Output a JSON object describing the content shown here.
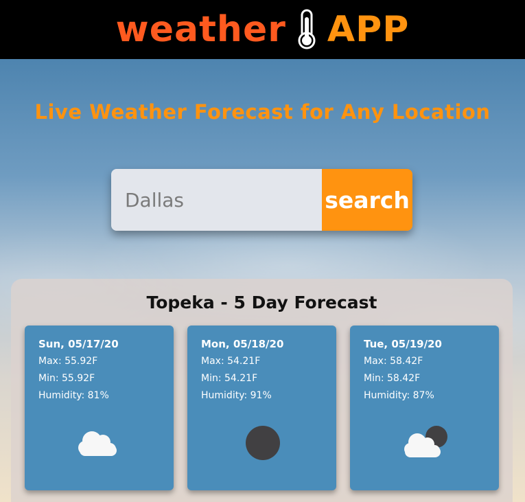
{
  "header": {
    "brand_word_1": "weather",
    "brand_word_2": "APP",
    "brand_icon": "thermometer-icon",
    "colors": {
      "background": "#000000",
      "weather": "#ff5a1f",
      "app": "#ff9310"
    }
  },
  "headline": "Live Weather Forecast for Any Location",
  "search": {
    "value": "",
    "placeholder": "Dallas",
    "button_label": "search",
    "button_color": "#ff9310"
  },
  "forecast": {
    "title": "Topeka - 5 Day Forecast",
    "days": [
      {
        "date": "Sun, 05/17/20",
        "max": "Max: 55.92F",
        "min": "Min: 55.92F",
        "humidity": "Humidity: 81%",
        "icon": "cloudy-icon"
      },
      {
        "date": "Mon, 05/18/20",
        "max": "Max: 54.21F",
        "min": "Min: 54.21F",
        "humidity": "Humidity: 91%",
        "icon": "clear-night-icon"
      },
      {
        "date": "Tue, 05/19/20",
        "max": "Max: 58.42F",
        "min": "Min: 58.42F",
        "humidity": "Humidity: 87%",
        "icon": "partly-cloudy-night-icon"
      }
    ],
    "card_color": "#4a8dba"
  }
}
